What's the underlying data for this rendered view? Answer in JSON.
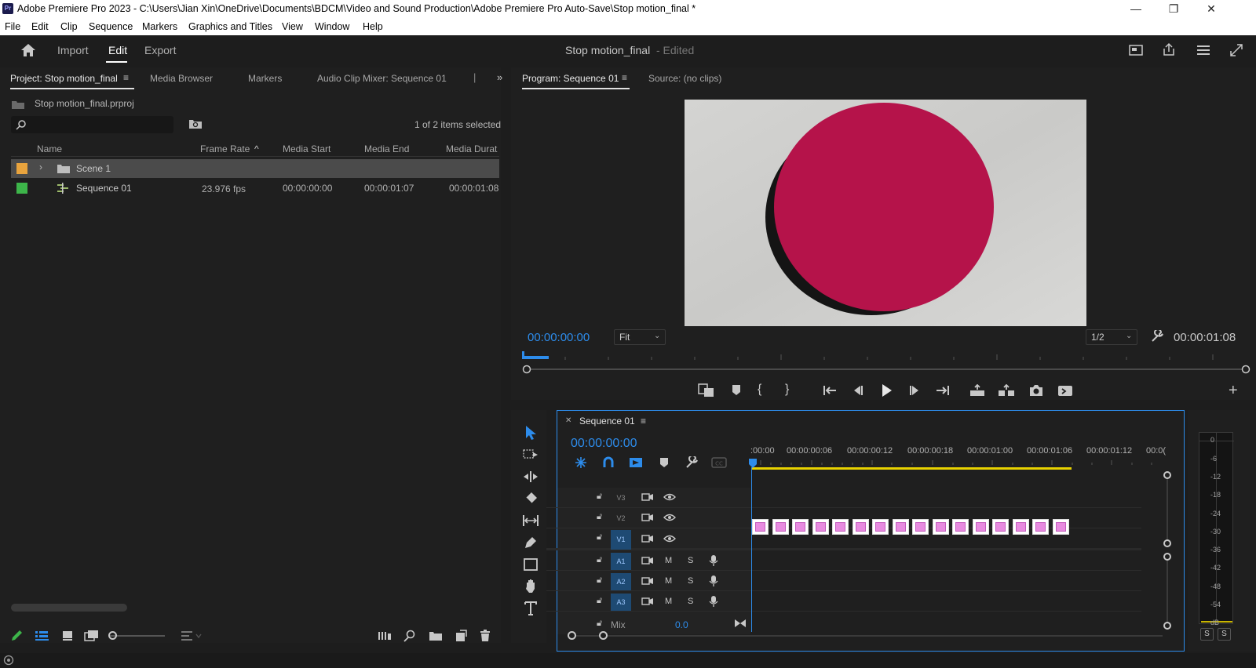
{
  "window": {
    "logo_text": "Pr",
    "title": "Adobe Premiere Pro 2023 - C:\\Users\\Jian Xin\\OneDrive\\Documents\\BDCM\\Video and Sound Production\\Adobe Premiere Pro Auto-Save\\Stop motion_final *",
    "controls": [
      "minimize-icon",
      "restore-icon",
      "close-icon"
    ]
  },
  "menu": [
    "File",
    "Edit",
    "Clip",
    "Sequence",
    "Markers",
    "Graphics and Titles",
    "View",
    "Window",
    "Help"
  ],
  "workspace": {
    "tabs": [
      "Import",
      "Edit",
      "Export"
    ],
    "active_tab": "Edit",
    "project_title": "Stop motion_final",
    "status": "- Edited"
  },
  "project_panel": {
    "tabs": [
      "Project: Stop motion_final",
      "Media Browser",
      "Markers",
      "Audio Clip Mixer: Sequence 01"
    ],
    "file_name": "Stop motion_final.prproj",
    "search_placeholder": "",
    "selection_status": "1 of 2 items selected",
    "columns": [
      "Name",
      "Frame Rate",
      "Media Start",
      "Media End",
      "Media Durat"
    ],
    "items": [
      {
        "color": "#e8a33d",
        "name": "Scene 1",
        "type": "bin",
        "frame_rate": "",
        "media_start": "",
        "media_end": "",
        "media_duration": ""
      },
      {
        "color": "#3db54a",
        "name": "Sequence 01",
        "type": "sequence",
        "frame_rate": "23.976 fps",
        "media_start": "00:00:00:00",
        "media_end": "00:00:01:07",
        "media_duration": "00:00:01:08"
      }
    ]
  },
  "program_monitor": {
    "tabs": [
      "Program: Sequence 01",
      "Source: (no clips)"
    ],
    "timecode": "00:00:00:00",
    "zoom": "Fit",
    "resolution": "1/2",
    "duration": "00:00:01:08"
  },
  "timeline": {
    "sequence_name": "Sequence 01",
    "timecode": "00:00:00:00",
    "ruler_labels": [
      ":00:00",
      "00:00:00:06",
      "00:00:00:12",
      "00:00:00:18",
      "00:00:01:00",
      "00:00:01:06",
      "00:00:01:12",
      "00:0("
    ],
    "video_tracks": [
      "V3",
      "V2",
      "V1"
    ],
    "audio_tracks": [
      "A1",
      "A2",
      "A3"
    ],
    "mute_label": "M",
    "solo_label": "S",
    "mix_label": "Mix",
    "mix_value": "0.0",
    "clip_count": 16
  },
  "audio_meter": {
    "scale": [
      "0",
      "-6",
      "-12",
      "-18",
      "-24",
      "-30",
      "-36",
      "-42",
      "-48",
      "-54",
      "dB"
    ],
    "solo_buttons": [
      "S",
      "S"
    ]
  },
  "colors": {
    "accent": "#2d8ceb",
    "panel_bg": "#1f1f1f",
    "clip": "#e88be0"
  }
}
